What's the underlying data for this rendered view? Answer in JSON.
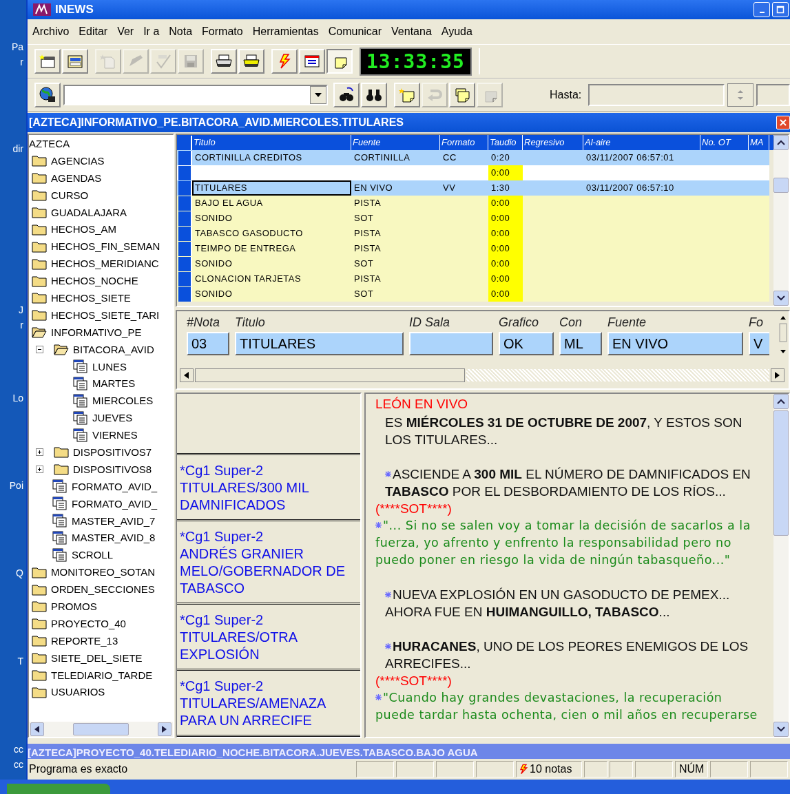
{
  "desktop_labels": [
    "Pa",
    "r",
    "dir",
    "J",
    "r",
    "Lo",
    "Poi",
    "Q",
    "T",
    "cc",
    "cc"
  ],
  "window": {
    "title": "INEWS"
  },
  "menu": [
    "Archivo",
    "Editar",
    "Ver",
    "Ir a",
    "Nota",
    "Formato",
    "Herramientas",
    "Comunicar",
    "Ventana",
    "Ayuda"
  ],
  "toolbar": [
    [
      {
        "kind": "new-window",
        "disabled": false,
        "pressed": false
      },
      {
        "kind": "open",
        "disabled": false,
        "pressed": false
      }
    ],
    [
      {
        "kind": "new-doc",
        "disabled": true,
        "pressed": false
      },
      {
        "kind": "edit",
        "disabled": true,
        "pressed": false
      },
      {
        "kind": "spellcheck",
        "disabled": true,
        "pressed": false
      },
      {
        "kind": "save",
        "disabled": true,
        "pressed": false
      }
    ],
    [
      {
        "kind": "print",
        "disabled": false,
        "pressed": false
      },
      {
        "kind": "print-color",
        "disabled": false,
        "pressed": false
      }
    ],
    [
      {
        "kind": "lightning",
        "disabled": false,
        "pressed": false
      },
      {
        "kind": "message",
        "disabled": false,
        "pressed": false
      },
      {
        "kind": "note",
        "disabled": false,
        "pressed": true
      }
    ]
  ],
  "clock": "13:33:35",
  "search_bar": {
    "group1": [
      {
        "kind": "globe",
        "disabled": false
      },
      {
        "kind": "person-search",
        "disabled": false
      },
      {
        "kind": "binoculars",
        "disabled": false
      }
    ],
    "group2": [
      {
        "kind": "note-new",
        "disabled": false
      },
      {
        "kind": "undo",
        "disabled": true
      },
      {
        "kind": "notes",
        "disabled": false
      },
      {
        "kind": "grid",
        "disabled": true
      }
    ],
    "hasta_label": "Hasta:"
  },
  "document": {
    "title": "[AZTECA]INFORMATIVO_PE.BITACORA_AVID.MIERCOLES.TITULARES"
  },
  "tree": {
    "label": "AZTECA",
    "children": [
      {
        "label": "AGENCIAS",
        "kind": "folder"
      },
      {
        "label": "AGENDAS",
        "kind": "folder"
      },
      {
        "label": "CURSO",
        "kind": "folder"
      },
      {
        "label": "GUADALAJARA",
        "kind": "folder"
      },
      {
        "label": "HECHOS_AM",
        "kind": "folder"
      },
      {
        "label": "HECHOS_FIN_SEMAN",
        "kind": "folder"
      },
      {
        "label": "HECHOS_MERIDIANC",
        "kind": "folder"
      },
      {
        "label": "HECHOS_NOCHE",
        "kind": "folder"
      },
      {
        "label": "HECHOS_SIETE",
        "kind": "folder"
      },
      {
        "label": "HECHOS_SIETE_TARI",
        "kind": "folder"
      },
      {
        "label": "INFORMATIVO_PE",
        "kind": "folder",
        "expanded": true,
        "children": [
          {
            "label": "BITACORA_AVID",
            "kind": "folder",
            "expanded": true,
            "children": [
              {
                "label": "LUNES",
                "kind": "queue"
              },
              {
                "label": "MARTES",
                "kind": "queue"
              },
              {
                "label": "MIERCOLES",
                "kind": "queue"
              },
              {
                "label": "JUEVES",
                "kind": "queue"
              },
              {
                "label": "VIERNES",
                "kind": "queue"
              }
            ]
          },
          {
            "label": "DISPOSITIVOS7",
            "kind": "folder",
            "expanded": false
          },
          {
            "label": "DISPOSITIVOS8",
            "kind": "folder",
            "expanded": false
          },
          {
            "label": "FORMATO_AVID_",
            "kind": "queue"
          },
          {
            "label": "FORMATO_AVID_",
            "kind": "queue"
          },
          {
            "label": "MASTER_AVID_7",
            "kind": "queue"
          },
          {
            "label": "MASTER_AVID_8",
            "kind": "queue"
          },
          {
            "label": "SCROLL",
            "kind": "queue"
          }
        ]
      },
      {
        "label": "MONITOREO_SOTAN",
        "kind": "folder"
      },
      {
        "label": "ORDEN_SECCIONES",
        "kind": "folder"
      },
      {
        "label": "PROMOS",
        "kind": "folder"
      },
      {
        "label": "PROYECTO_40",
        "kind": "folder"
      },
      {
        "label": "REPORTE_13",
        "kind": "folder"
      },
      {
        "label": "SIETE_DEL_SIETE",
        "kind": "folder"
      },
      {
        "label": "TELEDIARIO_TARDE",
        "kind": "folder"
      },
      {
        "label": "USUARIOS",
        "kind": "folder"
      }
    ]
  },
  "table": {
    "columns": [
      "Titulo",
      "Fuente",
      "Formato",
      "Taudio",
      "Regresivo",
      "Al-aire",
      "No. OT",
      "MA"
    ],
    "rows": [
      {
        "kind": "aired",
        "focused": false,
        "cells": [
          "CORTINILLA CREDITOS",
          "CORTINILLA",
          "CC",
          "0:20",
          null,
          "03/11/2007 06:57:01",
          null,
          null
        ]
      },
      {
        "kind": "blank",
        "focused": false,
        "cells": [
          null,
          null,
          null,
          "0:00",
          null,
          null,
          null,
          null
        ]
      },
      {
        "kind": "aired",
        "focused": true,
        "cells": [
          "TITULARES",
          "EN VIVO",
          "VV",
          "1:30",
          null,
          "03/11/2007 06:57:10",
          null,
          null
        ]
      },
      {
        "kind": "pending",
        "focused": false,
        "cells": [
          "BAJO EL AGUA",
          "PISTA",
          null,
          "0:00",
          null,
          null,
          null,
          null
        ]
      },
      {
        "kind": "pending",
        "focused": false,
        "cells": [
          "SONIDO",
          "SOT",
          null,
          "0:00",
          null,
          null,
          null,
          null
        ]
      },
      {
        "kind": "pending",
        "focused": false,
        "cells": [
          "TABASCO GASODUCTO",
          "PISTA",
          null,
          "0:00",
          null,
          null,
          null,
          null
        ]
      },
      {
        "kind": "pending",
        "focused": false,
        "cells": [
          "TEIMPO DE ENTREGA",
          "PISTA",
          null,
          "0:00",
          null,
          null,
          null,
          null
        ]
      },
      {
        "kind": "pending",
        "focused": false,
        "cells": [
          "SONIDO",
          "SOT",
          null,
          "0:00",
          null,
          null,
          null,
          null
        ]
      },
      {
        "kind": "pending",
        "focused": false,
        "cells": [
          "CLONACION TARJETAS",
          "PISTA",
          null,
          "0:00",
          null,
          null,
          null,
          null
        ]
      },
      {
        "kind": "pending",
        "focused": false,
        "cells": [
          "SONIDO",
          "SOT",
          null,
          "0:00",
          null,
          null,
          null,
          null
        ]
      }
    ]
  },
  "form": [
    {
      "label": "#Nota",
      "value": "03"
    },
    {
      "label": "Titulo",
      "value": "TITULARES"
    },
    {
      "label": "ID Sala"
    },
    {
      "label": "Grafico",
      "value": "OK"
    },
    {
      "label": "Con",
      "value": "ML"
    },
    {
      "label": "Fuente",
      "value": "EN VIVO"
    },
    {
      "label": "Fo",
      "value": "V"
    }
  ],
  "cg_cards": [
    {
      "lines": [
        "*Cg1 Super-2",
        "TITULARES/300 MIL",
        "DAMNIFICADOS"
      ]
    },
    {
      "lines": [
        "*Cg1 Super-2",
        "ANDRÉS GRANIER",
        "MELO/GOBERNADOR DE",
        "TABASCO"
      ]
    },
    {
      "lines": [
        "*Cg1 Super-2",
        "TITULARES/OTRA",
        "EXPLOSIÓN"
      ]
    },
    {
      "lines": [
        "*Cg1 Super-2",
        "TITULARES/AMENAZA",
        "PARA UN ARRECIFE"
      ]
    }
  ],
  "script": [
    {
      "kind": "cue",
      "marker": false,
      "space_before": false,
      "text": "LEÓN EN VIVO"
    },
    {
      "kind": "script",
      "marker": false,
      "space_before": false,
      "text": "ES **MIÉRCOLES 31 DE OCTUBRE DE 2007**, Y ESTOS SON LOS TITULARES..."
    },
    {
      "kind": "script",
      "marker": true,
      "space_before": true,
      "text": "ASCIENDE A **300 MIL** EL NÚMERO DE DAMNIFICADOS EN **TABASCO** POR EL DESBORDAMIENTO DE LOS RÍOS..."
    },
    {
      "kind": "cue",
      "marker": false,
      "space_before": false,
      "text": "(****SOT****)"
    },
    {
      "kind": "quote",
      "marker": true,
      "space_before": false,
      "text": "\"... Si no se salen voy a tomar la decisión de sacarlos a la fuerza, yo afrento y enfrento la responsabilidad pero no puedo poner en riesgo la vida de ningún tabasqueño...\""
    },
    {
      "kind": "script",
      "marker": true,
      "space_before": true,
      "text": "NUEVA EXPLOSIÓN EN UN GASODUCTO DE PEMEX... AHORA FUE EN **HUIMANGUILLO, TABASCO**..."
    },
    {
      "kind": "script",
      "marker": true,
      "space_before": true,
      "text": "**HURACANES**, UNO DE LOS PEORES ENEMIGOS DE LOS ARRECIFES..."
    },
    {
      "kind": "cue",
      "marker": false,
      "space_before": false,
      "text": "(****SOT****)"
    },
    {
      "kind": "quote",
      "marker": true,
      "space_before": false,
      "text": "\"Cuando hay grandes devastaciones, la recuperación puede tardar hasta ochenta, cien o mil años en recuperarse"
    }
  ],
  "background_window": {
    "title": "[AZTECA]PROYECTO_40.TELEDIARIO_NOCHE.BITACORA.JUEVES.TABASCO.BAJO AGUA"
  },
  "status_bar": {
    "message": "Programa es exacto",
    "notes": "10 notas",
    "num": "NÚM"
  }
}
